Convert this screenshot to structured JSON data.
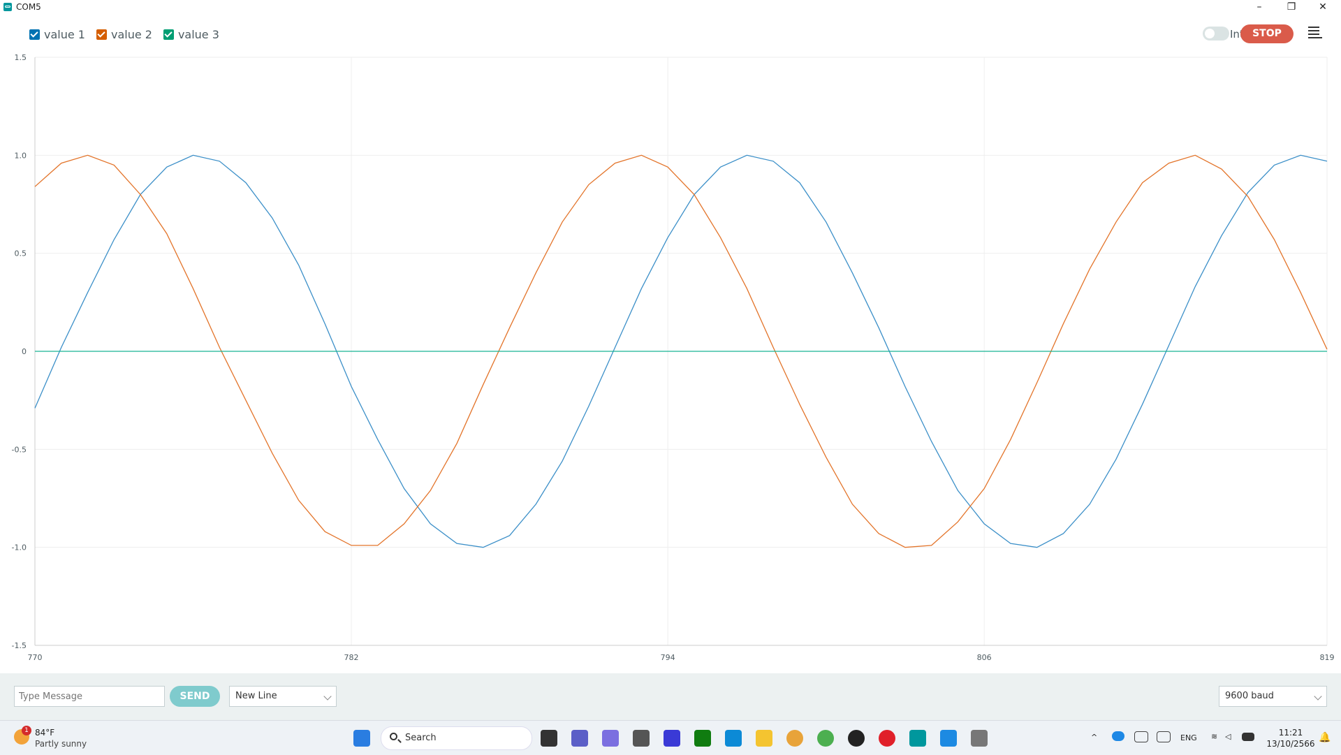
{
  "window": {
    "title": "COM5"
  },
  "legend": [
    {
      "label": "value 1",
      "color": "#0072b2"
    },
    {
      "label": "value 2",
      "color": "#d55e00"
    },
    {
      "label": "value 3",
      "color": "#009e73"
    }
  ],
  "toolbar": {
    "interpolate_label": "Interpolate",
    "interpolate_on": false,
    "stop_label": "STOP"
  },
  "chart_data": {
    "type": "line",
    "x": [
      770,
      771,
      772,
      773,
      774,
      775,
      776,
      777,
      778,
      779,
      780,
      781,
      782,
      783,
      784,
      785,
      786,
      787,
      788,
      789,
      790,
      791,
      792,
      793,
      794,
      795,
      796,
      797,
      798,
      799,
      800,
      801,
      802,
      803,
      804,
      805,
      806,
      807,
      808,
      809,
      810,
      811,
      812,
      813,
      814,
      815,
      816,
      817,
      818,
      819
    ],
    "series": [
      {
        "name": "value 1",
        "color": "#3b8fc8",
        "values": [
          -0.29,
          0.02,
          0.3,
          0.57,
          0.8,
          0.94,
          1.0,
          0.97,
          0.86,
          0.68,
          0.44,
          0.14,
          -0.18,
          -0.45,
          -0.7,
          -0.88,
          -0.98,
          -1.0,
          -0.94,
          -0.78,
          -0.56,
          -0.28,
          0.02,
          0.32,
          0.58,
          0.8,
          0.94,
          1.0,
          0.97,
          0.86,
          0.66,
          0.4,
          0.12,
          -0.18,
          -0.46,
          -0.71,
          -0.88,
          -0.98,
          -1.0,
          -0.93,
          -0.78,
          -0.55,
          -0.27,
          0.03,
          0.33,
          0.59,
          0.81,
          0.95,
          1.0,
          0.97
        ]
      },
      {
        "name": "value 2",
        "color": "#e3742a",
        "values": [
          0.84,
          0.96,
          1.0,
          0.95,
          0.8,
          0.6,
          0.32,
          0.02,
          -0.25,
          -0.52,
          -0.76,
          -0.92,
          -0.99,
          -0.99,
          -0.88,
          -0.71,
          -0.47,
          -0.17,
          0.12,
          0.4,
          0.66,
          0.85,
          0.96,
          1.0,
          0.94,
          0.8,
          0.58,
          0.32,
          0.02,
          -0.27,
          -0.54,
          -0.78,
          -0.93,
          -1.0,
          -0.99,
          -0.87,
          -0.7,
          -0.45,
          -0.16,
          0.14,
          0.42,
          0.66,
          0.86,
          0.96,
          1.0,
          0.93,
          0.79,
          0.57,
          0.3,
          0.01
        ]
      },
      {
        "name": "value 3",
        "color": "#19b394",
        "values": [
          0,
          0,
          0,
          0,
          0,
          0,
          0,
          0,
          0,
          0,
          0,
          0,
          0,
          0,
          0,
          0,
          0,
          0,
          0,
          0,
          0,
          0,
          0,
          0,
          0,
          0,
          0,
          0,
          0,
          0,
          0,
          0,
          0,
          0,
          0,
          0,
          0,
          0,
          0,
          0,
          0,
          0,
          0,
          0,
          0,
          0,
          0,
          0,
          0,
          0
        ]
      }
    ],
    "xlim": [
      770,
      819
    ],
    "ylim": [
      -1.5,
      1.5
    ],
    "xticks": [
      "770",
      "782",
      "794",
      "806",
      "819"
    ],
    "yticks": [
      "1.5",
      "1.0",
      "0.5",
      "0",
      "-0.5",
      "-1.0",
      "-1.5"
    ],
    "grid": true
  },
  "bottom": {
    "message_placeholder": "Type Message",
    "send_label": "SEND",
    "line_ending": "New Line",
    "baud": "9600 baud"
  },
  "taskbar": {
    "weather_temp": "84°F",
    "weather_desc": "Partly sunny",
    "weather_badge": "1",
    "search_label": "Search",
    "lang": "ENG",
    "time": "11:21",
    "date": "13/10/2566"
  }
}
